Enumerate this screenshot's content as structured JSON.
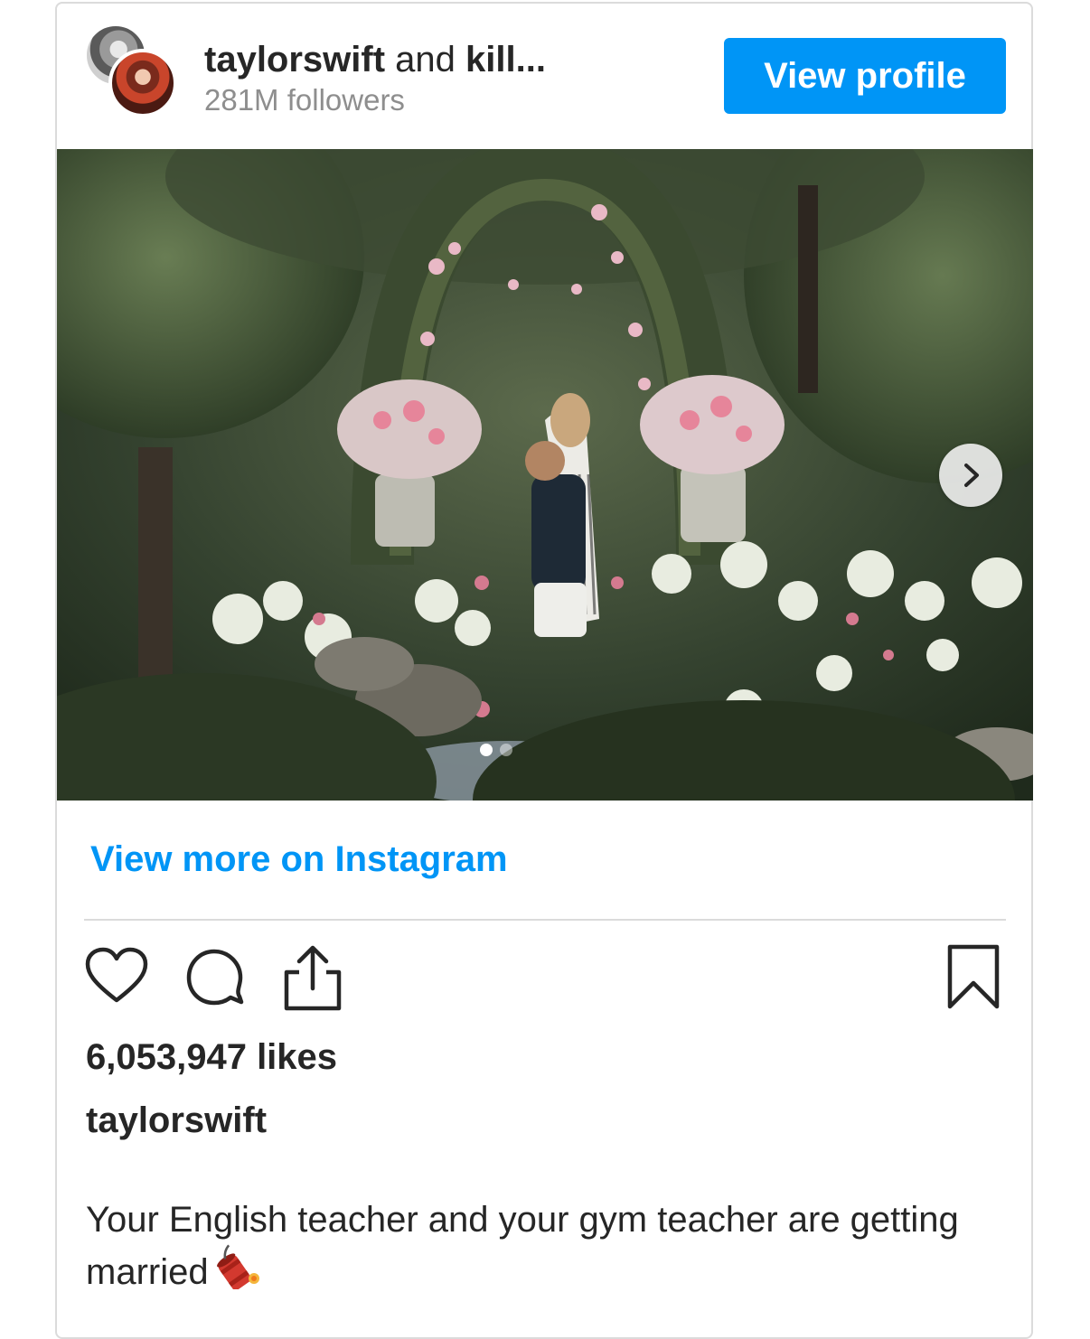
{
  "post": {
    "account_primary": "taylorswift",
    "account_joiner": "and",
    "account_secondary": "kill...",
    "followers": "281M followers",
    "view_profile_label": "View profile",
    "view_more_label": "View more on Instagram",
    "likes": "6,053,947 likes",
    "caption_user": "taylorswift",
    "caption_text": "Your English teacher and your gym teacher are getting married",
    "caption_emoji": "firecracker-emoji",
    "carousel": {
      "active_index": 1,
      "total": 2
    }
  },
  "icons": {
    "like": "heart-icon",
    "comment": "comment-icon",
    "share": "share-icon",
    "save": "bookmark-icon",
    "next": "chevron-right-icon"
  },
  "colors": {
    "accent": "#0095f6",
    "text": "#262626",
    "muted": "#8e8e8e",
    "border": "#dbdbdb"
  }
}
